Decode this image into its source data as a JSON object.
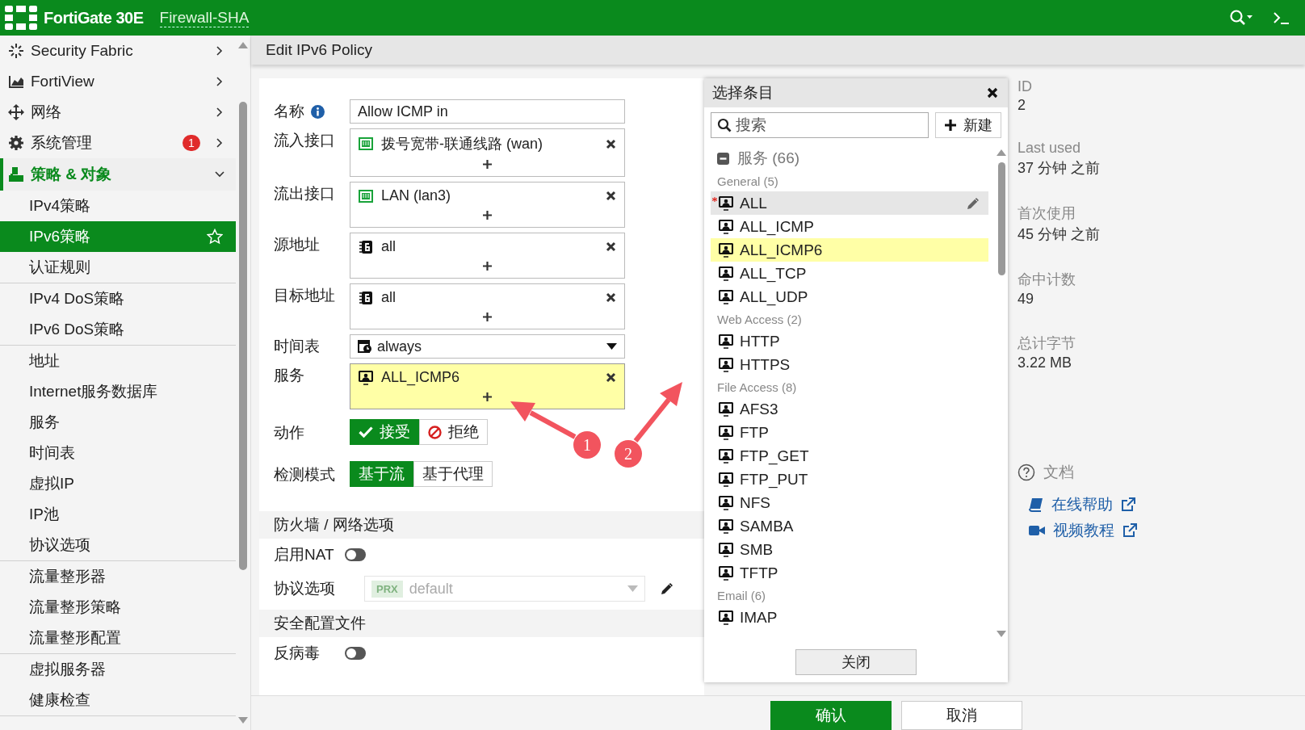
{
  "topbar": {
    "product": "FortiGate 30E",
    "hostname": "Firewall-SHA"
  },
  "sidebar": {
    "items": [
      {
        "label": "Security Fabric",
        "kind": "fabric",
        "expanded": false
      },
      {
        "label": "FortiView",
        "kind": "chart",
        "expanded": false
      },
      {
        "label": "网络",
        "kind": "network",
        "expanded": false
      },
      {
        "label": "系统管理",
        "kind": "gear",
        "expanded": false,
        "badge": "1"
      },
      {
        "label": "策略 & 对象",
        "kind": "policy",
        "expanded": true,
        "sections": [
          {
            "items": [
              {
                "label": "IPv4策略",
                "selected": false
              },
              {
                "label": "IPv6策略",
                "selected": true
              },
              {
                "label": "认证规则",
                "selected": false
              }
            ]
          },
          {
            "items": [
              {
                "label": "IPv4 DoS策略",
                "selected": false
              },
              {
                "label": "IPv6 DoS策略",
                "selected": false
              }
            ]
          },
          {
            "items": [
              {
                "label": "地址",
                "selected": false
              },
              {
                "label": "Internet服务数据库",
                "selected": false
              },
              {
                "label": "服务",
                "selected": false
              },
              {
                "label": "时间表",
                "selected": false
              },
              {
                "label": "虚拟IP",
                "selected": false
              },
              {
                "label": "IP池",
                "selected": false
              },
              {
                "label": "协议选项",
                "selected": false
              }
            ]
          },
          {
            "items": [
              {
                "label": "流量整形器",
                "selected": false
              },
              {
                "label": "流量整形策略",
                "selected": false
              },
              {
                "label": "流量整形配置",
                "selected": false
              }
            ]
          },
          {
            "items": [
              {
                "label": "虚拟服务器",
                "selected": false
              },
              {
                "label": "健康检查",
                "selected": false
              }
            ]
          }
        ]
      }
    ]
  },
  "page": {
    "title": "Edit IPv6 Policy"
  },
  "form": {
    "fields": [
      {
        "label": "名称",
        "kind": "text",
        "value": "Allow ICMP in",
        "info": true
      },
      {
        "label": "流入接口",
        "kind": "multi",
        "selected": false,
        "entries": [
          {
            "kind": "port",
            "text": "拨号宽带-联通线路 (wan)"
          }
        ]
      },
      {
        "label": "流出接口",
        "kind": "multi",
        "selected": false,
        "entries": [
          {
            "kind": "port",
            "text": "LAN (lan3)"
          }
        ]
      },
      {
        "label": "源地址",
        "kind": "multi",
        "selected": false,
        "entries": [
          {
            "kind": "address",
            "text": "all"
          }
        ]
      },
      {
        "label": "目标地址",
        "kind": "multi",
        "selected": false,
        "entries": [
          {
            "kind": "address",
            "text": "all"
          }
        ]
      },
      {
        "label": "时间表",
        "kind": "dropdown",
        "value": "always"
      },
      {
        "label": "服务",
        "kind": "multi",
        "selected": true,
        "entries": [
          {
            "kind": "service",
            "text": "ALL_ICMP6"
          }
        ]
      },
      {
        "label": "动作",
        "kind": "segmented",
        "options": [
          {
            "label": "接受",
            "kind": "accept",
            "selected": true
          },
          {
            "label": "拒绝",
            "kind": "deny",
            "selected": false
          }
        ]
      },
      {
        "label": "检测模式",
        "kind": "segmented",
        "options": [
          {
            "label": "基于流",
            "selected": true
          },
          {
            "label": "基于代理",
            "selected": false
          }
        ]
      }
    ],
    "sections": [
      {
        "title": "防火墙 / 网络选项",
        "rows": [
          {
            "label": "启用NAT",
            "kind": "toggle",
            "on": false
          },
          {
            "label": "协议选项",
            "kind": "dropdown",
            "disabled": true,
            "tag": "PRX",
            "value": "default",
            "editable": true
          }
        ]
      },
      {
        "title": "安全配置文件",
        "rows": [
          {
            "label": "反病毒",
            "kind": "toggle",
            "on": false
          }
        ]
      }
    ]
  },
  "picker": {
    "title": "选择条目",
    "search": {
      "placeholder": "搜索"
    },
    "new_button": "新建",
    "group": {
      "label": "服务 (66)",
      "expanded": true
    },
    "categories": [
      {
        "label": "General (5)",
        "items": [
          {
            "label": "ALL",
            "selected": false,
            "hovered": true,
            "marked": true
          },
          {
            "label": "ALL_ICMP",
            "selected": false,
            "hovered": false,
            "marked": false
          },
          {
            "label": "ALL_ICMP6",
            "selected": true,
            "hovered": false,
            "marked": false
          },
          {
            "label": "ALL_TCP",
            "selected": false,
            "hovered": false,
            "marked": false
          },
          {
            "label": "ALL_UDP",
            "selected": false,
            "hovered": false,
            "marked": false
          }
        ]
      },
      {
        "label": "Web Access (2)",
        "items": [
          {
            "label": "HTTP",
            "selected": false,
            "hovered": false,
            "marked": false
          },
          {
            "label": "HTTPS",
            "selected": false,
            "hovered": false,
            "marked": false
          }
        ]
      },
      {
        "label": "File Access (8)",
        "items": [
          {
            "label": "AFS3",
            "selected": false,
            "hovered": false,
            "marked": false
          },
          {
            "label": "FTP",
            "selected": false,
            "hovered": false,
            "marked": false
          },
          {
            "label": "FTP_GET",
            "selected": false,
            "hovered": false,
            "marked": false
          },
          {
            "label": "FTP_PUT",
            "selected": false,
            "hovered": false,
            "marked": false
          },
          {
            "label": "NFS",
            "selected": false,
            "hovered": false,
            "marked": false
          },
          {
            "label": "SAMBA",
            "selected": false,
            "hovered": false,
            "marked": false
          },
          {
            "label": "SMB",
            "selected": false,
            "hovered": false,
            "marked": false
          },
          {
            "label": "TFTP",
            "selected": false,
            "hovered": false,
            "marked": false
          }
        ]
      },
      {
        "label": "Email (6)",
        "items": [
          {
            "label": "IMAP",
            "selected": false,
            "hovered": false,
            "marked": false
          }
        ]
      }
    ],
    "close_button": "关闭"
  },
  "info": {
    "stats": [
      {
        "label": "ID",
        "value": "2"
      },
      {
        "label": "Last used",
        "value": "37 分钟 之前"
      },
      {
        "label": "首次使用",
        "value": "45 分钟 之前"
      },
      {
        "label": "命中计数",
        "value": "49"
      },
      {
        "label": "总计字节",
        "value": "3.22 MB"
      }
    ],
    "docs": {
      "title": "文档",
      "links": [
        {
          "kind": "book",
          "label": "在线帮助"
        },
        {
          "kind": "video",
          "label": "视频教程"
        }
      ]
    }
  },
  "footer": {
    "buttons": [
      {
        "label": "确认",
        "primary": true
      },
      {
        "label": "取消",
        "primary": false
      }
    ]
  },
  "annotations": [
    {
      "number": "1"
    },
    {
      "number": "2"
    }
  ]
}
